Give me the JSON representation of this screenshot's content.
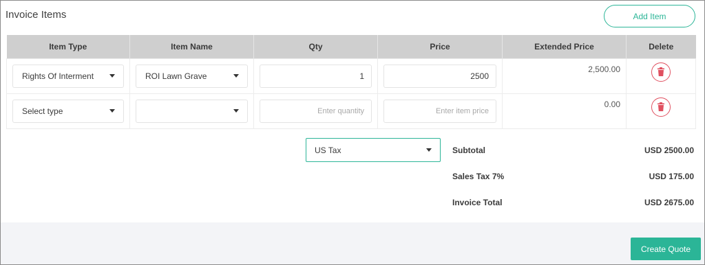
{
  "header": {
    "title": "Invoice Items",
    "add_item_label": "Add Item"
  },
  "table": {
    "columns": [
      "Item Type",
      "Item Name",
      "Qty",
      "Price",
      "Extended Price",
      "Delete"
    ],
    "rows": [
      {
        "item_type": "Rights Of Interment",
        "item_name": "ROI Lawn Grave",
        "qty": "1",
        "price": "2500",
        "extended_price": "2,500.00"
      },
      {
        "item_type": "Select type",
        "item_name": "",
        "qty_placeholder": "Enter quantity",
        "price_placeholder": "Enter item price",
        "extended_price": "0.00"
      }
    ]
  },
  "tax": {
    "selected": "US Tax"
  },
  "summary": {
    "subtotal_label": "Subtotal",
    "subtotal_value": "USD 2500.00",
    "sales_tax_label": "Sales Tax 7%",
    "sales_tax_value": "USD 175.00",
    "total_label": "Invoice Total",
    "total_value": "USD 2675.00"
  },
  "footer": {
    "create_quote_label": "Create Quote"
  },
  "colors": {
    "accent": "#2bb597",
    "delete": "#e05060",
    "header_bg": "#cfcfcf"
  },
  "icons": {
    "delete": "trash-icon",
    "dropdown": "caret-down-icon"
  }
}
